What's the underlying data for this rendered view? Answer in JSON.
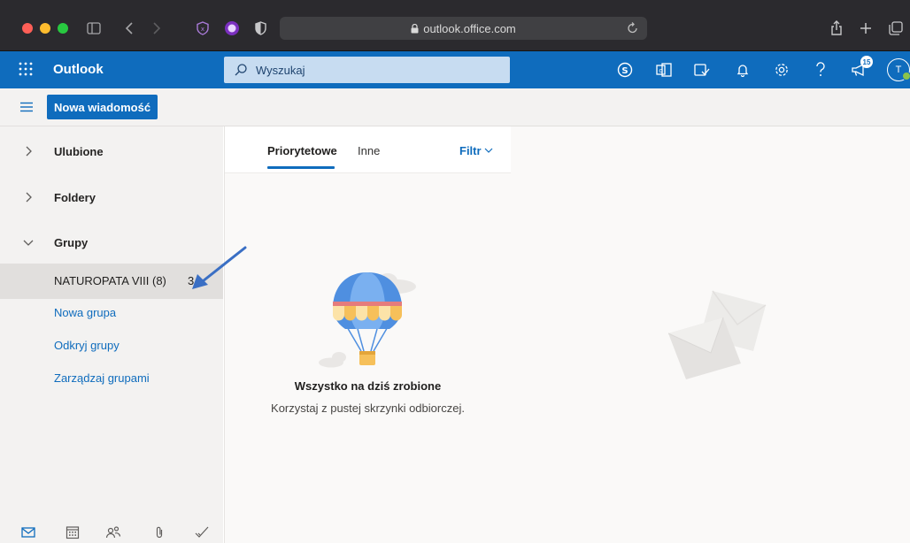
{
  "browser": {
    "url": "outlook.office.com",
    "icons": [
      "sidebar-toggle-icon",
      "back-icon",
      "forward-icon",
      "privacy-icon",
      "extension-icon",
      "shield-icon",
      "lock-icon",
      "reload-icon",
      "share-icon",
      "new-tab-icon",
      "tabs-overview-icon"
    ]
  },
  "appbar": {
    "title": "Outlook",
    "search_placeholder": "Wyszukaj",
    "notification_count": "15",
    "avatar_initial": "T",
    "icons": [
      "skype-icon",
      "office-icon",
      "tasks-icon",
      "bell-icon",
      "gear-icon",
      "help-icon",
      "megaphone-icon"
    ]
  },
  "command": {
    "new_message": "Nowa wiadomość"
  },
  "sidebar": {
    "favorites": "Ulubione",
    "folders": "Foldery",
    "groups": "Grupy",
    "group_item": {
      "name": "NATUROPATA VIII (8)",
      "count": "3"
    },
    "links": [
      "Nowa grupa",
      "Odkryj grupy",
      "Zarządzaj grupami"
    ],
    "bottom_icons": [
      "mail-icon",
      "calendar-icon",
      "people-icon",
      "attachment-icon",
      "todo-icon"
    ]
  },
  "message_list": {
    "tabs": [
      "Priorytetowe",
      "Inne"
    ],
    "active_tab": "Priorytetowe",
    "filter": "Filtr",
    "empty_title": "Wszystko na dziś zrobione",
    "empty_subtitle": "Korzystaj z pustej skrzynki odbiorczej."
  },
  "colors": {
    "brand": "#0f6cbd",
    "sidebar_bg": "#f3f2f1",
    "chrome_bg": "#2b2a2e",
    "annotation_arrow": "#3a6fc4"
  }
}
